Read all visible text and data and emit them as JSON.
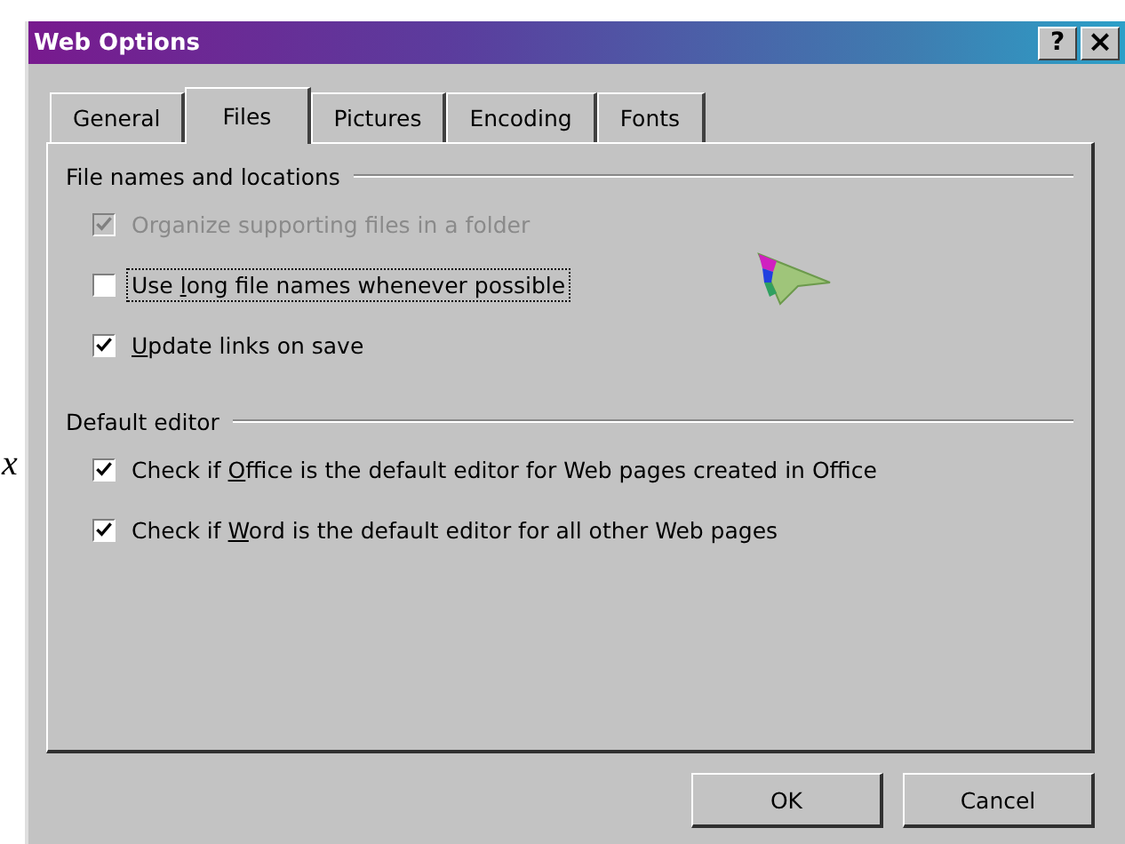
{
  "stray_text": "x",
  "window": {
    "title": "Web Options",
    "title_buttons": [
      {
        "kind": "help",
        "label": "?"
      },
      {
        "kind": "close",
        "label": "×"
      }
    ]
  },
  "tabs": [
    {
      "label": "General",
      "selected": false
    },
    {
      "label": "Files",
      "selected": true
    },
    {
      "label": "Pictures",
      "selected": false
    },
    {
      "label": "Encoding",
      "selected": false
    },
    {
      "label": "Fonts",
      "selected": false
    }
  ],
  "groups": [
    {
      "title": "File names and locations",
      "options": [
        {
          "post": "Organize supporting files in a folder",
          "checked": true,
          "disabled": true,
          "focused": false
        },
        {
          "pre": "Use ",
          "key": "l",
          "post": "ong file names whenever possible",
          "checked": false,
          "disabled": false,
          "focused": true
        },
        {
          "key": "U",
          "post": "pdate links on save",
          "checked": true,
          "disabled": false,
          "focused": false
        }
      ]
    },
    {
      "title": "Default editor",
      "options": [
        {
          "pre": "Check if ",
          "key": "O",
          "post": "ffice is the default editor for Web pages created in Office",
          "checked": true,
          "disabled": false,
          "focused": false
        },
        {
          "pre": "Check if ",
          "key": "W",
          "post": "ord is the default editor for all other Web pages",
          "checked": true,
          "disabled": false,
          "focused": false
        }
      ]
    }
  ],
  "buttons": [
    "OK",
    "Cancel"
  ]
}
